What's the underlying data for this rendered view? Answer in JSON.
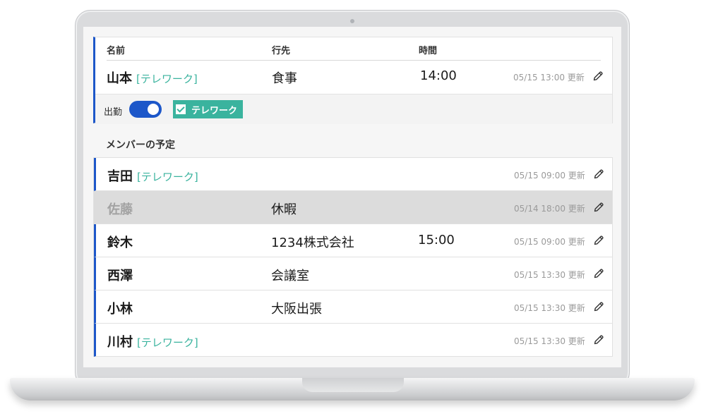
{
  "header": {
    "col_name": "名前",
    "col_dest": "行先",
    "col_time": "時間"
  },
  "self": {
    "name": "山本",
    "tag": "[テレワーク]",
    "destination": "食事",
    "time": "14:00",
    "updated": "05/15 13:00 更新",
    "attendance_label": "出勤",
    "attendance_on": true,
    "telework_label": "テレワーク",
    "telework_checked": true
  },
  "members_title": "メンバーの予定",
  "members": [
    {
      "name": "吉田",
      "tag": "[テレワーク]",
      "destination": "",
      "time": "",
      "updated": "05/15 09:00 更新",
      "off": false
    },
    {
      "name": "佐藤",
      "tag": "",
      "destination": "休暇",
      "time": "",
      "updated": "05/14 18:00 更新",
      "off": true
    },
    {
      "name": "鈴木",
      "tag": "",
      "destination": "1234株式会社",
      "time": "15:00",
      "updated": "05/15 09:00 更新",
      "off": false
    },
    {
      "name": "西澤",
      "tag": "",
      "destination": "会議室",
      "time": "",
      "updated": "05/15 13:30 更新",
      "off": false
    },
    {
      "name": "小林",
      "tag": "",
      "destination": "大阪出張",
      "time": "",
      "updated": "05/15 13:30 更新",
      "off": false
    },
    {
      "name": "川村",
      "tag": "[テレワーク]",
      "destination": "",
      "time": "",
      "updated": "05/15 13:30 更新",
      "off": false
    }
  ],
  "colors": {
    "accent": "#1d57c9",
    "telework": "#3ab39e",
    "absent_row": "#dcdcdc"
  }
}
